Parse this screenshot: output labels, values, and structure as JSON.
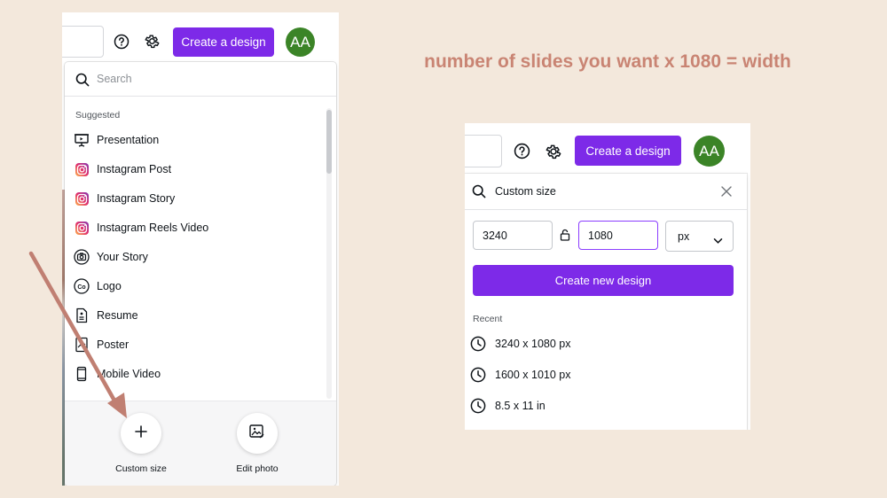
{
  "headline": "number of slides you want x 1080 = width",
  "colors": {
    "background": "#f3e8dc",
    "accent_purple": "#7d2ae8",
    "avatar_green": "#3b8427",
    "headline_text": "#c98473",
    "arrow": "#c07f72"
  },
  "left_panel": {
    "header": {
      "help_icon": "question-circle-icon",
      "settings_icon": "gear-icon",
      "create_button_label": "Create a design",
      "avatar_initials": "AA"
    },
    "dropdown": {
      "search_placeholder": "Search",
      "section_label": "Suggested",
      "items": [
        {
          "label": "Presentation",
          "icon": "presentation-icon"
        },
        {
          "label": "Instagram Post",
          "icon": "instagram-icon"
        },
        {
          "label": "Instagram Story",
          "icon": "instagram-icon"
        },
        {
          "label": "Instagram Reels Video",
          "icon": "instagram-icon"
        },
        {
          "label": "Your Story",
          "icon": "camera-circle-icon"
        },
        {
          "label": "Logo",
          "icon": "logo-co-icon"
        },
        {
          "label": "Resume",
          "icon": "document-icon"
        },
        {
          "label": "Poster",
          "icon": "poster-icon"
        },
        {
          "label": "Mobile Video",
          "icon": "mobile-icon"
        }
      ],
      "bottom_actions": [
        {
          "label": "Custom size",
          "icon": "plus-icon"
        },
        {
          "label": "Edit photo",
          "icon": "image-edit-icon"
        }
      ]
    }
  },
  "right_panel": {
    "header": {
      "help_icon": "question-circle-icon",
      "settings_icon": "gear-icon",
      "create_button_label": "Create a design",
      "avatar_initials": "AA"
    },
    "custom_size": {
      "search_text": "Custom size",
      "width_value": "3240",
      "height_value": "1080",
      "unit": "px",
      "create_button_label": "Create new design",
      "recent_label": "Recent",
      "recent_items": [
        "3240 x 1080 px",
        "1600 x 1010 px",
        "8.5 x 11 in"
      ]
    }
  }
}
